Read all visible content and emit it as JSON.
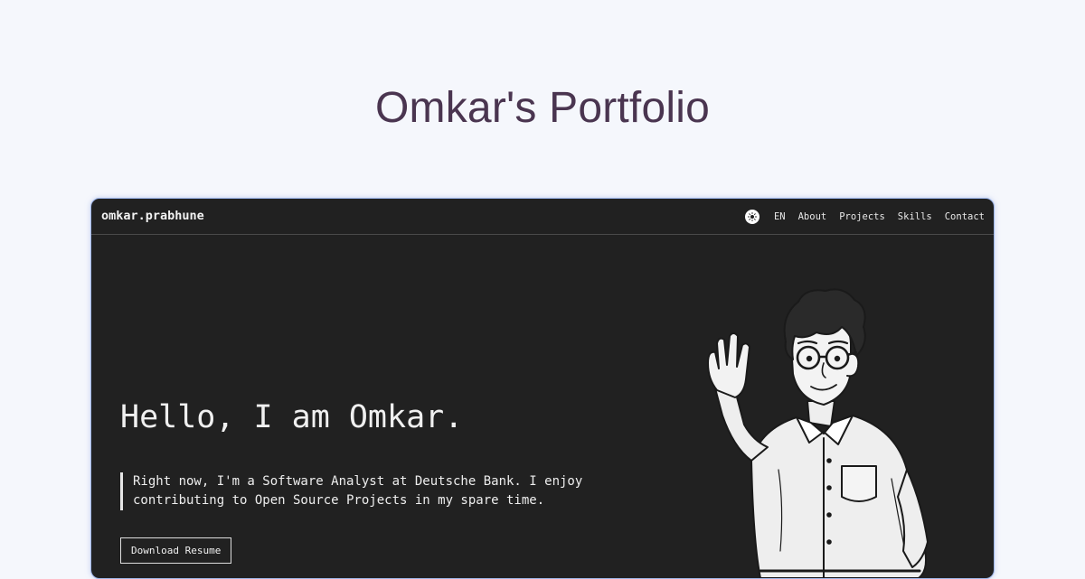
{
  "page": {
    "title": "Omkar's Portfolio"
  },
  "navbar": {
    "logo": "omkar.prabhune",
    "theme_toggle_icon": "sun-icon",
    "language": "EN",
    "items": [
      "About",
      "Projects",
      "Skills",
      "Contact"
    ]
  },
  "hero": {
    "heading": "Hello, I am Omkar.",
    "intro_line1": "Right now, I'm a Software Analyst at Deutsche Bank. I enjoy",
    "intro_line2": "contributing to Open Source Projects in my spare time.",
    "download_button": "Download Resume",
    "illustration_icon": "waving-person-illustration"
  },
  "colors": {
    "page_bg": "#f5f7fc",
    "title_color": "#4a3550",
    "panel_bg": "#212121",
    "panel_border": "#9db4e8",
    "text_light": "#f0f0f0"
  }
}
